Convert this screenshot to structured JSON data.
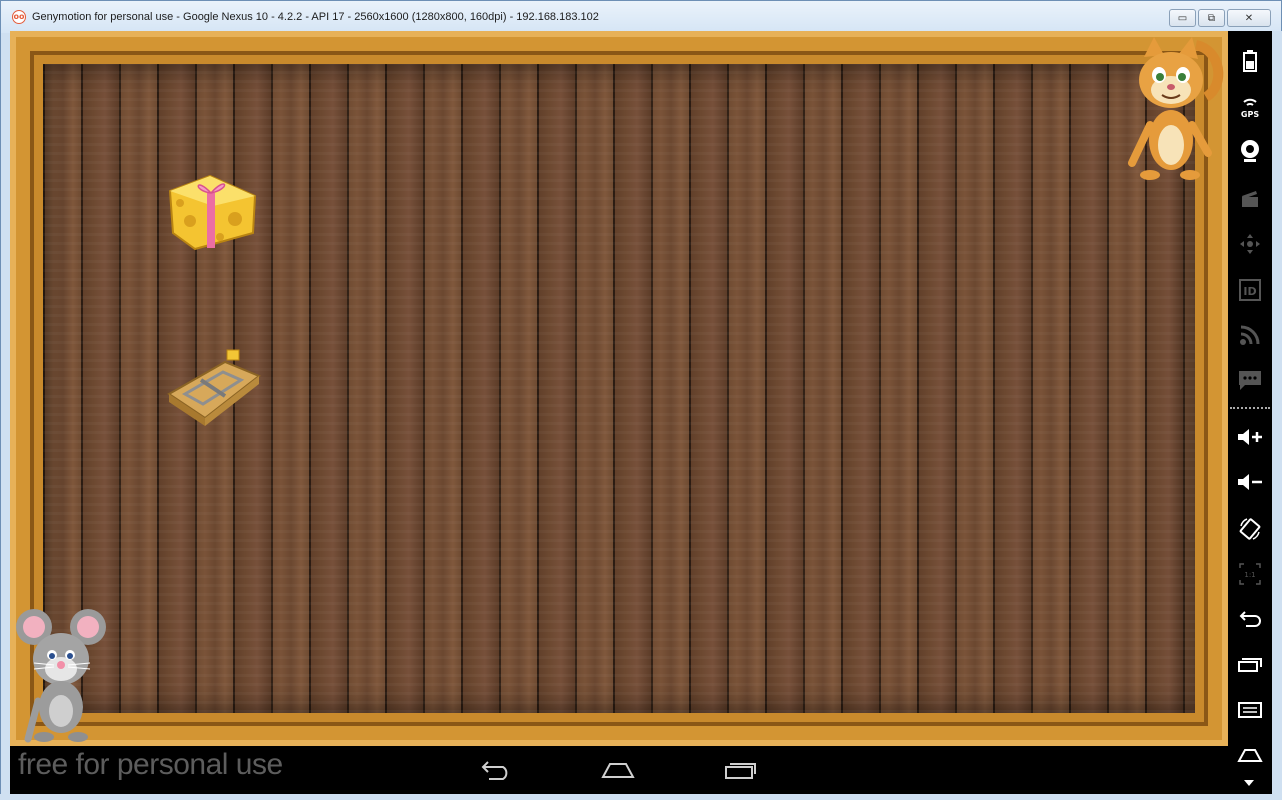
{
  "window": {
    "title": "Genymotion for personal use - Google Nexus 10 - 4.2.2 - API 17 - 2560x1600 (1280x800, 160dpi) - 192.168.183.102",
    "app_icon_glyph": "oo",
    "minimize_glyph": "▭",
    "maximize_glyph": "⧉",
    "close_glyph": "✕"
  },
  "game": {
    "items": [
      "cheese-gift",
      "mouse-trap",
      "cat",
      "mouse"
    ]
  },
  "navbar": {
    "watermark": "free for personal use",
    "buttons": [
      "back",
      "home",
      "recent-apps"
    ]
  },
  "sidebar": {
    "items": [
      "battery",
      "gps",
      "webcam",
      "screencast",
      "remote-control",
      "device-id",
      "network",
      "sms",
      "volume-up",
      "volume-down",
      "rotate",
      "scale",
      "back",
      "recent-apps",
      "menu",
      "home"
    ]
  },
  "colors": {
    "frame": "#d39533",
    "wood": "#6e4a31",
    "navbar": "#000000",
    "watermark": "#5d5d5d"
  }
}
